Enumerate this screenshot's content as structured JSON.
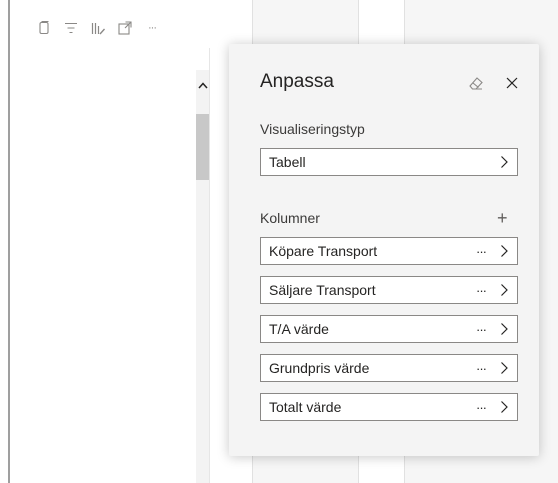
{
  "panel": {
    "title": "Anpassa",
    "visualization_type_label": "Visualiseringstyp",
    "visualization_type_value": "Tabell",
    "columns_label": "Kolumner",
    "add_label": "+",
    "columns": [
      {
        "label": "Köpare Transport"
      },
      {
        "label": "Säljare Transport"
      },
      {
        "label": "T/A värde"
      },
      {
        "label": "Grundpris värde"
      },
      {
        "label": "Totalt värde"
      }
    ],
    "more_glyph": "···"
  },
  "toolbar": {
    "icons": [
      "copy-icon",
      "filter-icon",
      "analytics-icon",
      "focus-mode-icon",
      "more-options-icon"
    ],
    "more_glyph": "···"
  },
  "colors": {
    "panel_bg": "#f4f4f4",
    "field_border": "#8a8886",
    "scroll_thumb": "#c8c8c8"
  }
}
